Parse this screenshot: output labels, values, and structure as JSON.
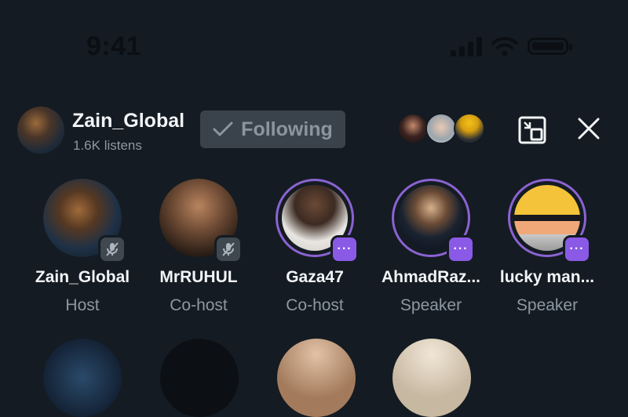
{
  "status_bar": {
    "time": "9:41",
    "icons": [
      "cellular-signal-icon",
      "wifi-icon",
      "battery-icon"
    ]
  },
  "header": {
    "host_name": "Zain_Global",
    "listens": "1.6K listens",
    "follow_button_label": "Following",
    "listener_avatars": [
      "listener-avatar-1",
      "listener-avatar-2",
      "listener-avatar-3"
    ],
    "actions": [
      "picture-in-picture-icon",
      "close-icon"
    ]
  },
  "participants": [
    {
      "name": "Zain_Global",
      "role": "Host",
      "badge": "muted-mic-icon"
    },
    {
      "name": "MrRUHUL",
      "role": "Co-host",
      "badge": "muted-mic-icon"
    },
    {
      "name": "Gaza47",
      "role": "Co-host",
      "badge": "more-options-icon"
    },
    {
      "name": "AhmadRaz...",
      "role": "Speaker",
      "badge": "more-options-icon"
    },
    {
      "name": "lucky man...",
      "role": "Speaker",
      "badge": "more-options-icon"
    }
  ],
  "badges": {
    "more_glyph": "···"
  },
  "colors": {
    "background": "#141b22",
    "accent_purple": "#8a5ae6",
    "following_bg": "#3a434c",
    "secondary_text": "#8d98a3"
  }
}
